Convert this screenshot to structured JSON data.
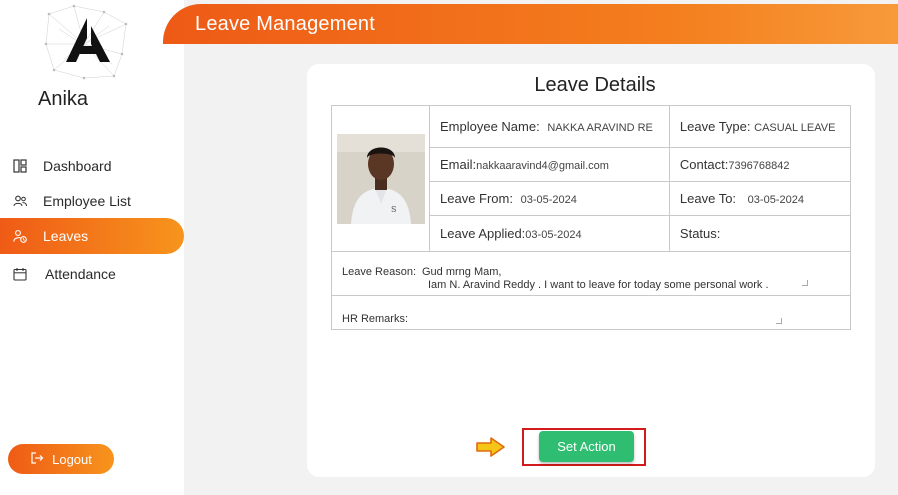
{
  "sidebar": {
    "brand": "Anika",
    "items": [
      {
        "label": "Dashboard",
        "icon": "dashboard-icon",
        "active": false
      },
      {
        "label": "Employee List",
        "icon": "users-icon",
        "active": false
      },
      {
        "label": "Leaves",
        "icon": "leave-user-icon",
        "active": true
      },
      {
        "label": "Attendance",
        "icon": "calendar-icon",
        "active": false
      }
    ],
    "logout_label": "Logout"
  },
  "header": {
    "title": "Leave Management"
  },
  "card": {
    "title": "Leave Details",
    "employee_name_label": "Employee Name:",
    "employee_name_value": "NAKKA ARAVIND RE",
    "leave_type_label": "Leave Type:",
    "leave_type_value": "CASUAL LEAVE",
    "email_label": "Email:",
    "email_value": "nakkaaravind4@gmail.com",
    "contact_label": "Contact:",
    "contact_value": "7396768842",
    "leave_from_label": "Leave From:",
    "leave_from_value": "03-05-2024",
    "leave_to_label": "Leave To:",
    "leave_to_value": "03-05-2024",
    "leave_applied_label": "Leave Applied:",
    "leave_applied_value": "03-05-2024",
    "status_label": "Status:",
    "status_value": "",
    "leave_reason_label": "Leave Reason:",
    "leave_reason_line1": "Gud mrng Mam,",
    "leave_reason_line2": "Iam N. Aravind Reddy . I want to leave for today some personal work .",
    "hr_remarks_label": "HR Remarks:",
    "hr_remarks_value": ""
  },
  "action": {
    "set_action_label": "Set Action"
  },
  "colors": {
    "accent_orange": "#ef5b16",
    "accent_orange_light": "#f7941d",
    "action_green": "#2fbd71",
    "highlight_red": "#d41b1b",
    "arrow_yellow": "#f5c518"
  }
}
